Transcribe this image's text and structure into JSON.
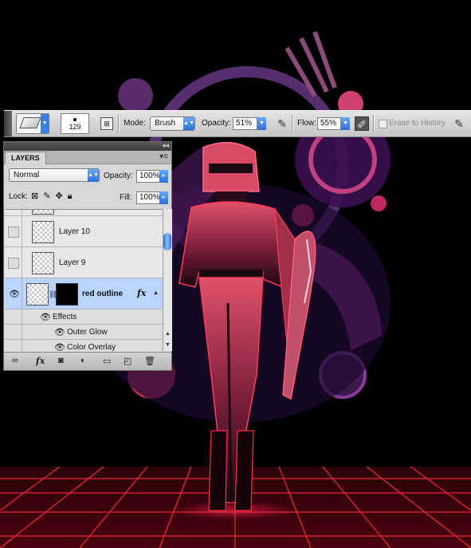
{
  "options_bar": {
    "brush_size": "129",
    "mode_label": "Mode:",
    "mode_value": "Brush",
    "opacity_label": "Opacity:",
    "opacity_value": "51%",
    "flow_label": "Flow:",
    "flow_value": "55%",
    "erase_history_label": "Erase to History",
    "icons": [
      "eraser-icon",
      "brush-preset-icon",
      "toggle-brush-palette-icon",
      "airbrush-icon",
      "tablet-pressure-icon"
    ]
  },
  "layers_panel": {
    "tab": "LAYERS",
    "blend_mode": "Normal",
    "opacity_label": "Opacity:",
    "opacity_value": "100%",
    "lock_label": "Lock:",
    "fill_label": "Fill:",
    "fill_value": "100%",
    "layers": [
      {
        "name": "Layer 10",
        "visible": false
      },
      {
        "name": "Layer 9",
        "visible": false
      },
      {
        "name": "red outline",
        "visible": true,
        "selected": true,
        "has_mask": true,
        "has_fx": true,
        "fx_label": "fx"
      }
    ],
    "effects_label": "Effects",
    "effects": [
      "Outer Glow",
      "Color Overlay"
    ]
  },
  "colors": {
    "accent_blue": "#2c6fd6",
    "selection": "#b8d4ff",
    "neon_red": "#ff2a4a",
    "neon_magenta": "#c8287a"
  }
}
